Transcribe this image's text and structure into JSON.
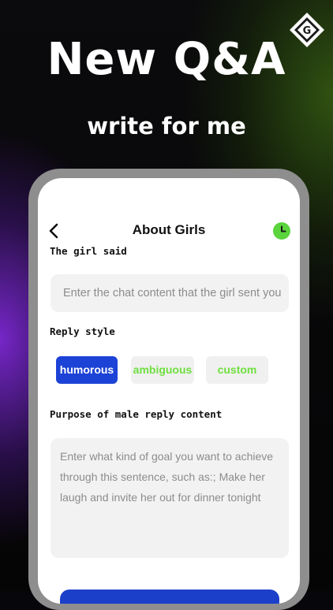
{
  "promo": {
    "title": "New Q&A",
    "subtitle": "write for me"
  },
  "brand": {
    "logo_letter": "G"
  },
  "screen": {
    "title": "About Girls"
  },
  "girl_said": {
    "label": "The girl said",
    "placeholder": "Enter the chat content that the girl sent you"
  },
  "reply_style": {
    "label": "Reply style",
    "options": [
      {
        "label": "humorous",
        "selected": true
      },
      {
        "label": "ambiguous",
        "selected": false
      },
      {
        "label": "custom",
        "selected": false
      }
    ]
  },
  "purpose": {
    "label": "Purpose of male reply content",
    "placeholder": "Enter what kind of goal you want to achieve through this sentence, such as:; Make her laugh and invite her out for dinner tonight"
  },
  "colors": {
    "accent_blue": "#1c42d6",
    "accent_green": "#5bd43d",
    "frame_gray": "#8e8e8e"
  },
  "icons": {
    "back": "chevron-left-icon",
    "history": "clock-icon",
    "logo": "g-diamond-logo"
  }
}
